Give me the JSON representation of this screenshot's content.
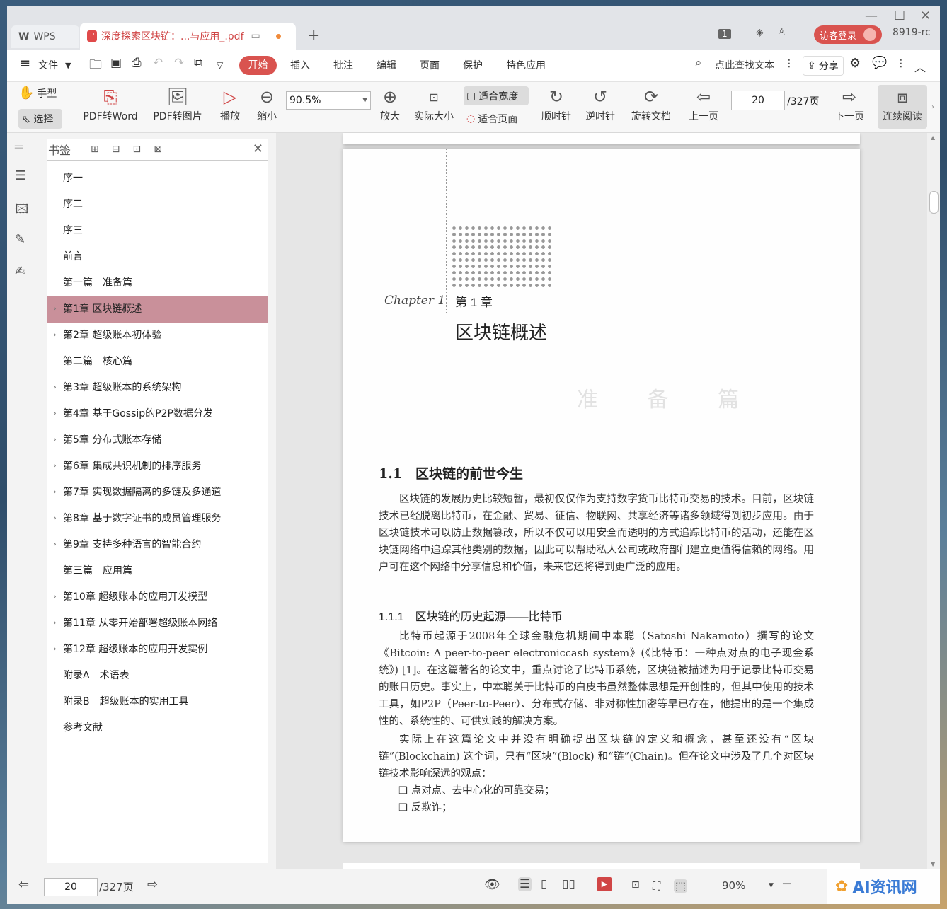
{
  "window": {
    "controls": [
      "—",
      "☐",
      "✕"
    ]
  },
  "tabs": {
    "wps_label": "WPS",
    "doc_title": "深度探索区块链：...与应用_.pdf",
    "new_tab": "+"
  },
  "titlebar_right": {
    "badge": "1",
    "login": "访客登录",
    "version": "8919-rc"
  },
  "menu": {
    "file": "文件",
    "items": [
      "开始",
      "插入",
      "批注",
      "编辑",
      "页面",
      "保护",
      "特色应用"
    ],
    "search": "点此查找文本",
    "share": "分享"
  },
  "ribbon": {
    "hand": "手型",
    "select": "选择",
    "pdf_to_word": "PDF转Word",
    "pdf_to_image": "PDF转图片",
    "play": "播放",
    "zoom_out": "缩小",
    "zoom_value": "90.5%",
    "zoom_in": "放大",
    "actual_size": "实际大小",
    "fit_width": "适合宽度",
    "fit_page": "适合页面",
    "clockwise": "顺时针",
    "counter_clockwise": "逆时针",
    "rotate_doc": "旋转文档",
    "prev_page": "上一页",
    "page_current": "20",
    "page_total": "/327页",
    "next_page": "下一页",
    "continuous": "连续阅读"
  },
  "bookmarks": {
    "title": "书签",
    "items": [
      {
        "label": "序一",
        "arrow": false,
        "active": false
      },
      {
        "label": "序二",
        "arrow": false,
        "active": false
      },
      {
        "label": "序三",
        "arrow": false,
        "active": false
      },
      {
        "label": "前言",
        "arrow": false,
        "active": false
      },
      {
        "label": "第一篇　准备篇",
        "arrow": false,
        "active": false
      },
      {
        "label": "第1章 区块链概述",
        "arrow": true,
        "active": true
      },
      {
        "label": "第2章 超级账本初体验",
        "arrow": true,
        "active": false
      },
      {
        "label": "第二篇　核心篇",
        "arrow": false,
        "active": false
      },
      {
        "label": "第3章 超级账本的系统架构",
        "arrow": true,
        "active": false
      },
      {
        "label": "第4章 基于Gossip的P2P数据分发",
        "arrow": true,
        "active": false
      },
      {
        "label": "第5章 分布式账本存储",
        "arrow": true,
        "active": false
      },
      {
        "label": "第6章 集成共识机制的排序服务",
        "arrow": true,
        "active": false
      },
      {
        "label": "第7章 实现数据隔离的多链及多通道",
        "arrow": true,
        "active": false
      },
      {
        "label": "第8章 基于数字证书的成员管理服务",
        "arrow": true,
        "active": false
      },
      {
        "label": "第9章 支持多种语言的智能合约",
        "arrow": true,
        "active": false
      },
      {
        "label": "第三篇　应用篇",
        "arrow": false,
        "active": false
      },
      {
        "label": "第10章 超级账本的应用开发模型",
        "arrow": true,
        "active": false
      },
      {
        "label": "第11章 从零开始部署超级账本网络",
        "arrow": true,
        "active": false
      },
      {
        "label": "第12章 超级账本的应用开发实例",
        "arrow": true,
        "active": false
      },
      {
        "label": "附录A　术语表",
        "arrow": false,
        "active": false
      },
      {
        "label": "附录B　超级账本的实用工具",
        "arrow": false,
        "active": false
      },
      {
        "label": "参考文献",
        "arrow": false,
        "active": false
      }
    ]
  },
  "document": {
    "chapter_en": "Chapter 1",
    "chapter_num": "第 1 章",
    "chapter_title": "区块链概述",
    "ghost_text": "准 备 篇",
    "section_heading": "1.1　区块链的前世今生",
    "para1": "区块链的发展历史比较短暂，最初仅仅作为支持数字货币比特币交易的技术。目前，区块链技术已经脱离比特币，在金融、贸易、征信、物联网、共享经济等诸多领域得到初步应用。由于区块链技术可以防止数据篡改，所以不仅可以用安全而透明的方式追踪比特币的活动，还能在区块链网络中追踪其他类别的数据，因此可以帮助私人公司或政府部门建立更值得信赖的网络。用户可在这个网络中分享信息和价值，未来它还将得到更广泛的应用。",
    "subsection_heading": "1.1.1　区块链的历史起源——比特币",
    "para2": "比特币起源于2008年全球金融危机期间中本聪（Satoshi Nakamoto）撰写的论文《Bitcoin: A peer-to-peer electroniccash system》(《比特币：一种点对点的电子现金系统》) [1]。在这篇著名的论文中，重点讨论了比特币系统，区块链被描述为用于记录比特币交易的账目历史。事实上，中本聪关于比特币的白皮书虽然整体思想是开创性的，但其中使用的技术工具，如P2P（Peer-to-Peer）、分布式存储、非对称性加密等早已存在，他提出的是一个集成性的、系统性的、可供实践的解决方案。",
    "para3": "实际上在这篇论文中并没有明确提出区块链的定义和概念，甚至还没有“区块链”(Blockchain) 这个词，只有“区块”(Block) 和“链”(Chain)。但在论文中涉及了几个对区块链技术影响深远的观点：",
    "list": [
      "❑ 点对点、去中心化的可靠交易；",
      "❑ 反欺诈；"
    ]
  },
  "statusbar": {
    "page_current": "20",
    "page_total": "/327页",
    "zoom": "90%",
    "watermark": "AI资讯网"
  }
}
